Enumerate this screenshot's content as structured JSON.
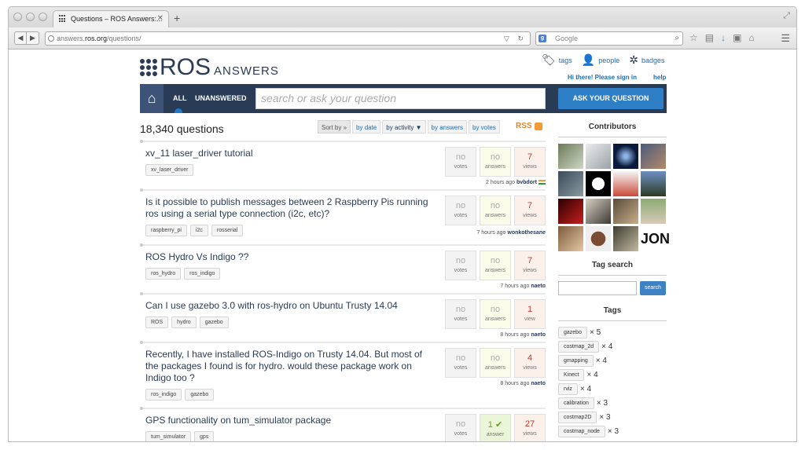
{
  "browser": {
    "tab_title": "Questions – ROS Answers:...",
    "tab_close": "✕",
    "url_plain": "answers.",
    "url_host": "ros.org",
    "url_path": "/questions/",
    "search_engine_placeholder": "Google"
  },
  "header": {
    "logo_main": "ROS",
    "logo_sub": "ANSWERS",
    "links": [
      {
        "label": "tags",
        "icon": "tag-icon"
      },
      {
        "label": "people",
        "icon": "person-icon"
      },
      {
        "label": "badges",
        "icon": "badge-icon"
      }
    ],
    "signin": "Hi there! Please sign in",
    "help": "help"
  },
  "navbar": {
    "tab_all": "ALL",
    "tab_unanswered": "UNANSWERED",
    "search_placeholder": "search or ask your question",
    "ask_button": "ASK YOUR QUESTION"
  },
  "main": {
    "question_count": "18,340 questions",
    "sort_label": "Sort by »",
    "sort_options": [
      "by date",
      "by activity ▼",
      "by answers",
      "by votes"
    ],
    "rss": "RSS"
  },
  "questions": [
    {
      "title": "xv_11 laser_driver tutorial",
      "tags": [
        "xv_laser_driver"
      ],
      "votes": "no",
      "votes_label": "votes",
      "answers": "no",
      "answers_label": "answers",
      "views": "7",
      "views_label": "views",
      "time": "2 hours ago",
      "user": "bvbdort"
    },
    {
      "title": "Is it possible to publish messages between 2 Raspberry Pis running ros using a serial type connection (i2c, etc)?",
      "tags": [
        "raspberry_pi",
        "i2c",
        "rosserial"
      ],
      "votes": "no",
      "votes_label": "votes",
      "answers": "no",
      "answers_label": "answers",
      "views": "7",
      "views_label": "views",
      "time": "7 hours ago",
      "user": "wonkothesane"
    },
    {
      "title": "ROS Hydro Vs Indigo ??",
      "tags": [
        "ros_hydro",
        "ros_indigo"
      ],
      "votes": "no",
      "votes_label": "votes",
      "answers": "no",
      "answers_label": "answers",
      "views": "7",
      "views_label": "views",
      "time": "7 hours ago",
      "user": "naeto"
    },
    {
      "title": "Can I use gazebo 3.0 with ros-hydro on Ubuntu Trusty 14.04",
      "tags": [
        "ROS",
        "hydro",
        "gazebo"
      ],
      "votes": "no",
      "votes_label": "votes",
      "answers": "no",
      "answers_label": "answers",
      "views": "1",
      "views_label": "view",
      "time": "8 hours ago",
      "user": "naeto"
    },
    {
      "title": "Recently, I have installed ROS-Indigo on Trusty 14.04. But most of the packages I found is for hydro. would these package work on Indigo too ?",
      "tags": [
        "ros_indigo",
        "gazebo"
      ],
      "votes": "no",
      "votes_label": "votes",
      "answers": "no",
      "answers_label": "answers",
      "views": "4",
      "views_label": "views",
      "time": "8 hours ago",
      "user": "naeto"
    },
    {
      "title": "GPS functionality on tum_simulator package",
      "tags": [
        "tum_simulator",
        "gps"
      ],
      "votes": "no",
      "votes_label": "votes",
      "answers": "1",
      "answers_label": "answer",
      "views": "27",
      "views_label": "views",
      "time": "",
      "user": ""
    }
  ],
  "sidebar": {
    "contributors_title": "Contributors",
    "contributor_last_label": "JON",
    "tag_search_title": "Tag search",
    "tag_search_button": "search",
    "tags_title": "Tags",
    "tags": [
      {
        "name": "gazebo",
        "count": "× 5"
      },
      {
        "name": "costmap_2d",
        "count": "× 4"
      },
      {
        "name": "gmapping",
        "count": "× 4"
      },
      {
        "name": "Kinect",
        "count": "× 4"
      },
      {
        "name": "rviz",
        "count": "× 4"
      },
      {
        "name": "calibration",
        "count": "× 3"
      },
      {
        "name": "costmap2D",
        "count": "× 3"
      },
      {
        "name": "costmap_node",
        "count": "× 3"
      }
    ]
  },
  "colors": {
    "navbar": "#2a3b55",
    "ask_button": "#2e7fc6",
    "link": "#1a6db5",
    "rss": "#e98424"
  }
}
